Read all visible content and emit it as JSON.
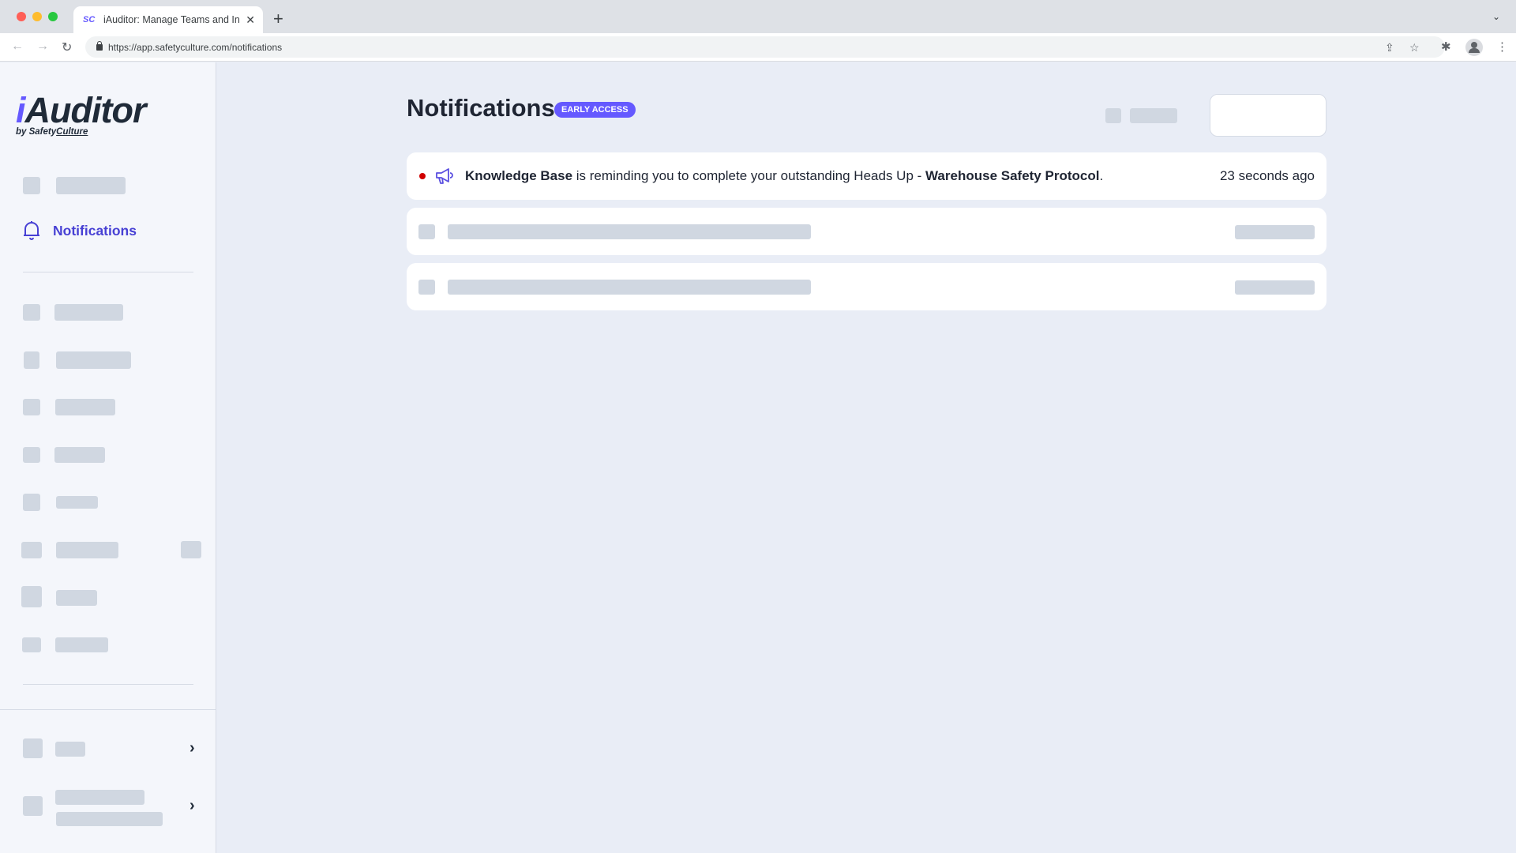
{
  "browser": {
    "tab_title": "iAuditor: Manage Teams and Ins",
    "tab_favicon": "SC",
    "url": "https://app.safetyculture.com/notifications",
    "icons": [
      "back-icon",
      "forward-icon",
      "reload-icon",
      "lock-icon",
      "share-icon",
      "star-icon",
      "extensions-icon",
      "profile-icon",
      "menu-icon"
    ]
  },
  "sidebar": {
    "logo_main": "Auditor",
    "logo_i": "i",
    "logo_by": "by Safety",
    "logo_culture": "Culture",
    "active_item": "Notifications"
  },
  "page": {
    "title": "Notifications",
    "badge": "EARLY ACCESS"
  },
  "notifications": [
    {
      "unread": true,
      "icon": "megaphone-icon",
      "source": "Knowledge Base",
      "message_middle": " is reminding you to complete your outstanding Heads Up - ",
      "subject": "Warehouse Safety Protocol",
      "suffix": ".",
      "time": "23 seconds ago"
    }
  ],
  "colors": {
    "accent": "#6559FF",
    "active_nav": "#4740D4",
    "unread_dot": "#D00000",
    "skeleton": "#D0D7E1"
  }
}
